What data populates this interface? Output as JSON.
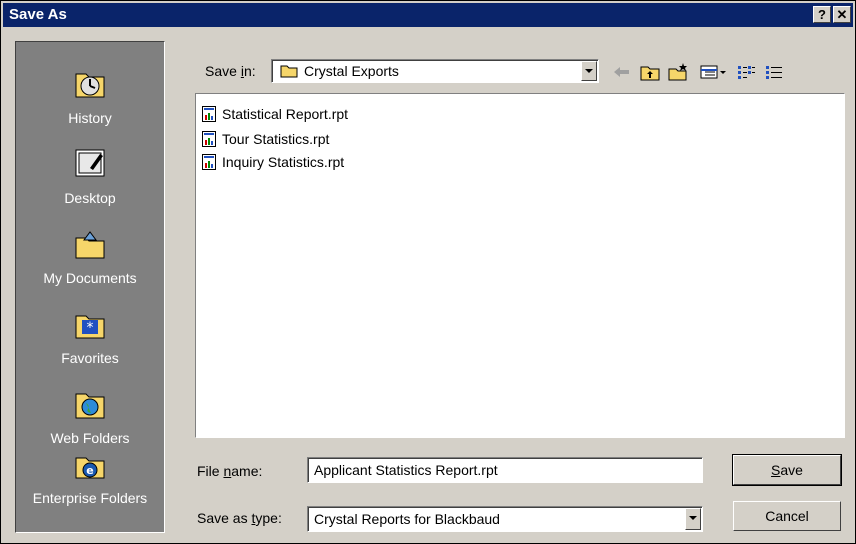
{
  "window": {
    "title": "Save As",
    "help_label": "?",
    "close_label": "✕"
  },
  "places": [
    {
      "label": "History",
      "icon": "history-icon"
    },
    {
      "label": "Desktop",
      "icon": "desktop-icon"
    },
    {
      "label": "My Documents",
      "icon": "my-documents-icon"
    },
    {
      "label": "Favorites",
      "icon": "favorites-icon"
    },
    {
      "label": "Web Folders",
      "icon": "web-folders-icon"
    },
    {
      "label": "Enterprise Folders",
      "icon": "enterprise-folders-icon"
    }
  ],
  "save_in": {
    "label_pre": "Save ",
    "label_accel": "i",
    "label_post": "n:",
    "value": "Crystal Exports"
  },
  "toolbar": {
    "icons": [
      "back-icon",
      "up-folder-icon",
      "new-folder-icon",
      "views-menu-icon",
      "list-view-icon",
      "details-view-icon"
    ]
  },
  "files": [
    {
      "name": "Statistical Report.rpt"
    },
    {
      "name": "Tour Statistics.rpt"
    },
    {
      "name": "Inquiry Statistics.rpt"
    }
  ],
  "file_name": {
    "label_pre": "File ",
    "label_accel": "n",
    "label_post": "ame:",
    "value": "Applicant Statistics Report.rpt"
  },
  "save_as_type": {
    "label_pre": "Save as ",
    "label_accel": "t",
    "label_post": "ype:",
    "value": "Crystal Reports for Blackbaud"
  },
  "buttons": {
    "save_accel": "S",
    "save_rest": "ave",
    "cancel": "Cancel"
  }
}
